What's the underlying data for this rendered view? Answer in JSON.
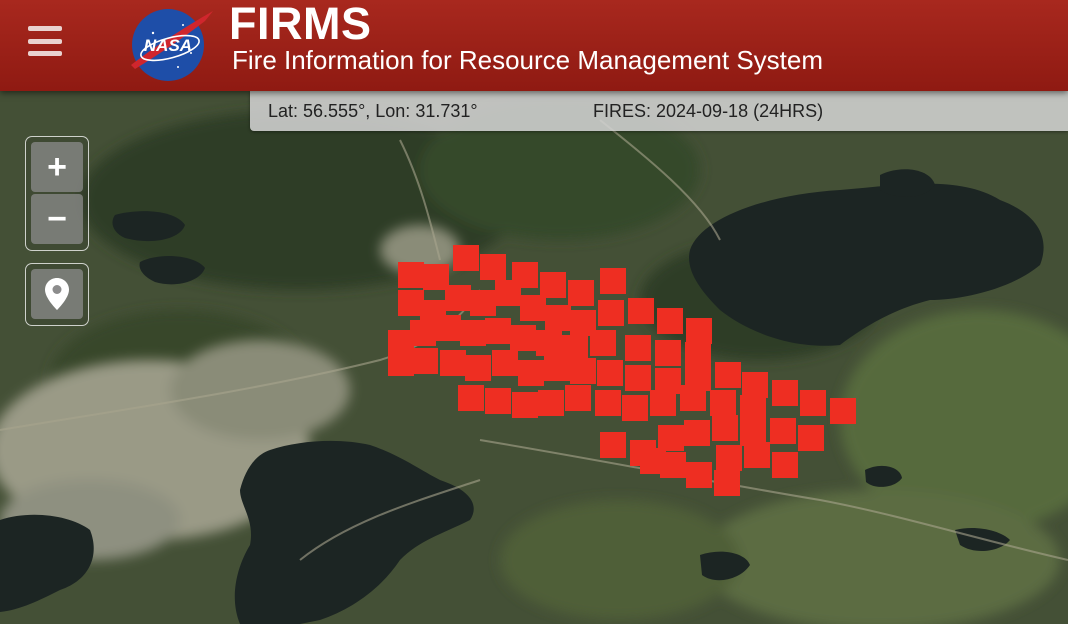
{
  "header": {
    "title": "FIRMS",
    "subtitle": "Fire Information for Resource Management System",
    "logo_text": "NASA",
    "menu_icon": "hamburger-menu-icon",
    "background_color": "#9a1f16"
  },
  "info_bar": {
    "coordinates": "Lat: 56.555°, Lon: 31.731°",
    "fires": "FIRES: 2024-09-18 (24HRS)"
  },
  "map_controls": {
    "zoom_in_label": "+",
    "zoom_out_label": "−",
    "locate_icon": "map-pin-icon"
  },
  "map": {
    "fire_marker_color": "#ee2e22",
    "terrain_color": "#3f4a32",
    "water_color": "#1a2220"
  }
}
